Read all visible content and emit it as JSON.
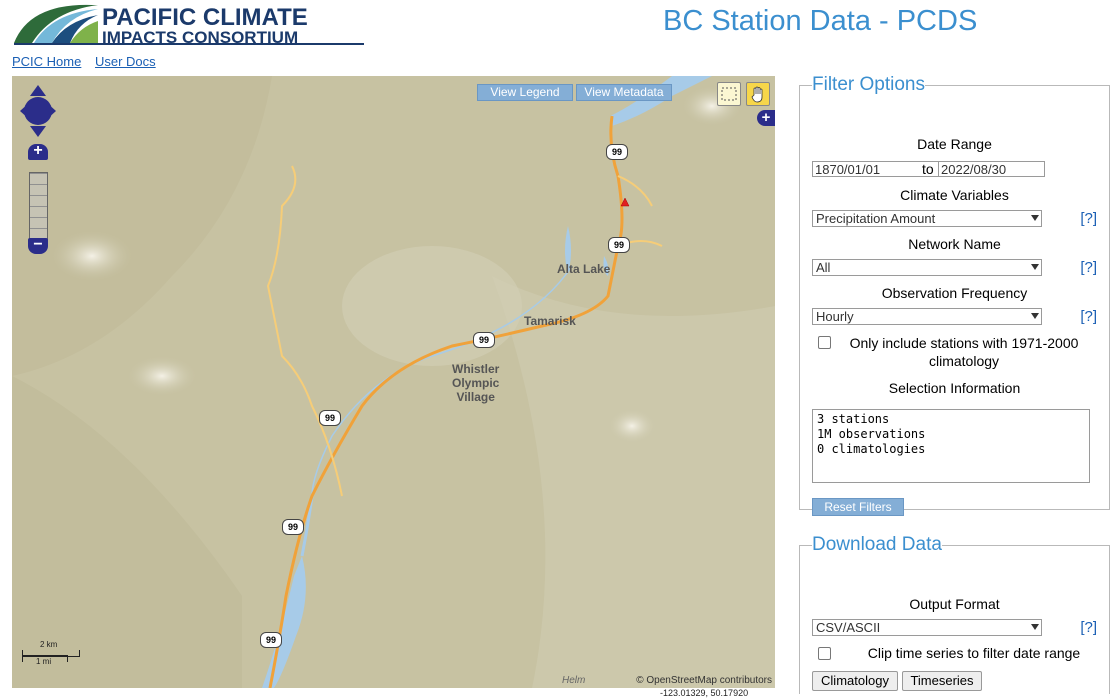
{
  "header": {
    "logo_text": "PACIFIC CLIMATE IMPACTS CONSORTIUM",
    "title": "BC Station Data - PCDS"
  },
  "nav": {
    "links": [
      "PCIC Home",
      "User Docs"
    ]
  },
  "map": {
    "buttons": {
      "legend": "View Legend",
      "metadata": "View Metadata"
    },
    "labels": {
      "alta_lake": "Alta Lake",
      "tamarisk": "Tamarisk",
      "whistler": "Whistler\nOlympic\nVillage",
      "route": "99"
    },
    "scale": {
      "km": "2 km",
      "mi": "1 mi"
    },
    "attribution": "© OpenStreetMap contributors",
    "helm": "Helm",
    "coords": "-123.01329, 50.17920"
  },
  "filter": {
    "legend": "Filter Options",
    "date_range_label": "Date Range",
    "date_from": "1870/01/01",
    "date_to_word": "to",
    "date_to": "2022/08/30",
    "climate_label": "Climate Variables",
    "climate_value": "Precipitation Amount",
    "network_label": "Network Name",
    "network_value": "All",
    "freq_label": "Observation Frequency",
    "freq_value": "Hourly",
    "help": "[?]",
    "climatology_check": "Only include stations with 1971-2000 climatology",
    "selection_label": "Selection Information",
    "selection_info": "3 stations\n1M observations\n0 climatologies",
    "reset": "Reset Filters"
  },
  "download": {
    "legend": "Download Data",
    "format_label": "Output Format",
    "format_value": "CSV/ASCII",
    "help": "[?]",
    "clip_label": "Clip time series to filter date range",
    "climatology_btn": "Climatology",
    "timeseries_btn": "Timeseries"
  },
  "colors": {
    "title_blue": "#3b8fcf",
    "button_blue": "#84aed6",
    "map_terrain": "#c9c5a8",
    "road_orange": "#f0a23a",
    "water_blue": "#a7cbe8"
  }
}
